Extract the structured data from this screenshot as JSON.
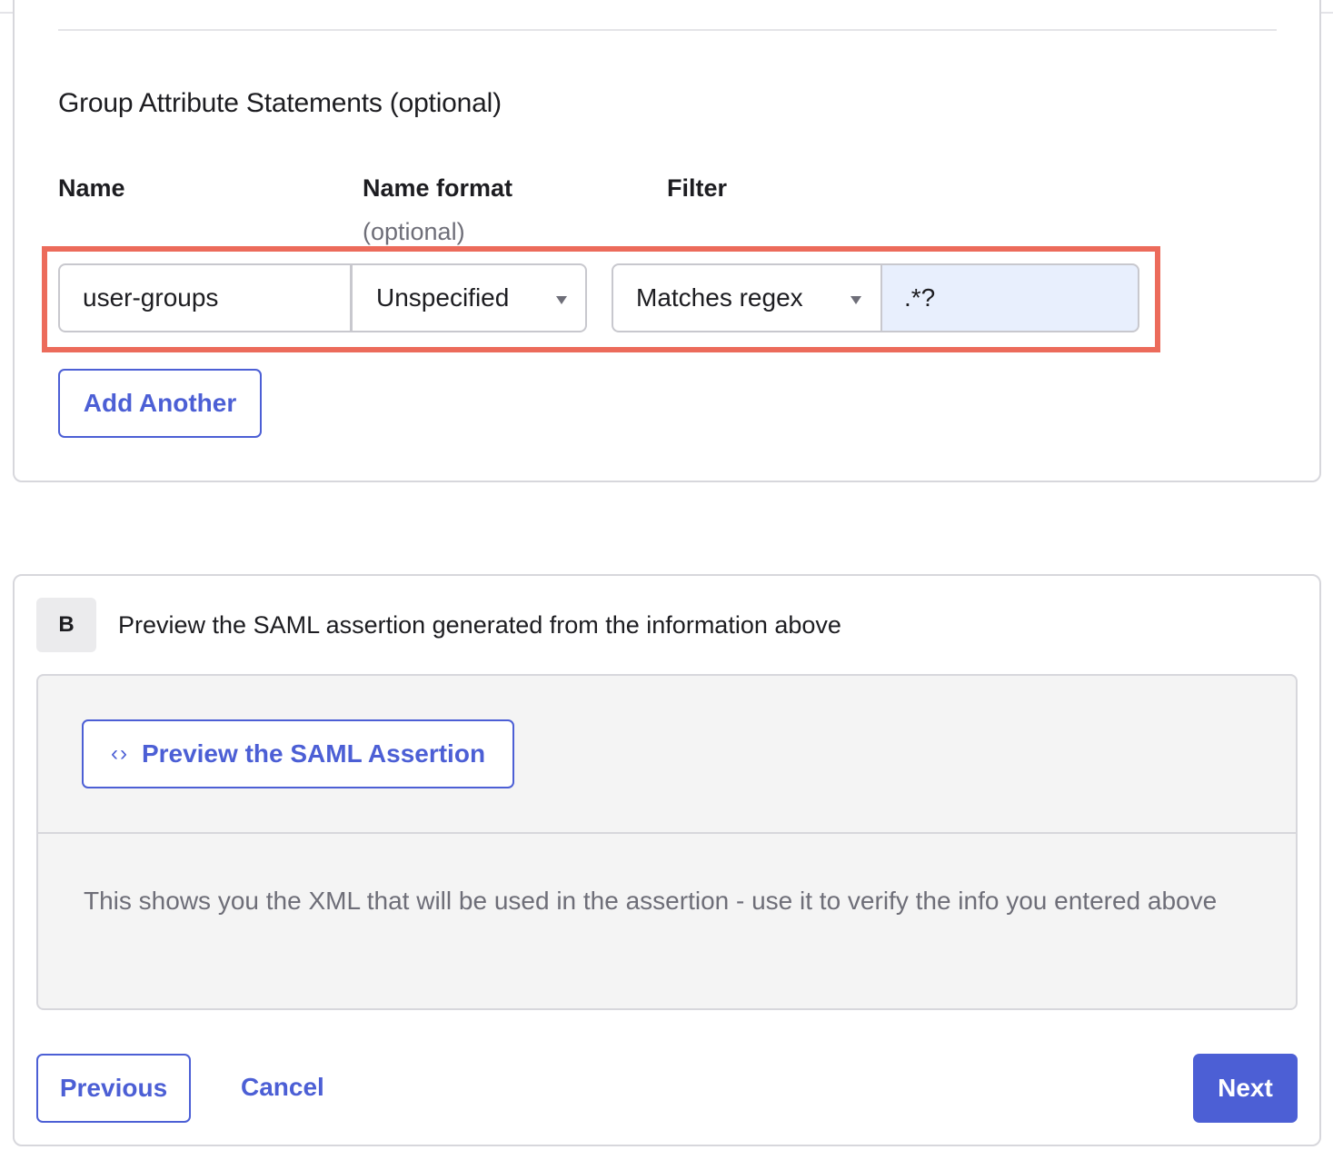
{
  "group_attributes": {
    "title": "Group Attribute Statements (optional)",
    "columns": {
      "name": "Name",
      "name_format": "Name format",
      "name_format_hint": "(optional)",
      "filter": "Filter"
    },
    "row": {
      "name_value": "user-groups",
      "name_format_value": "Unspecified",
      "filter_type_value": "Matches regex",
      "filter_value": ".*?"
    },
    "add_another_label": "Add Another",
    "highlight_color": "#ec6b5b"
  },
  "step_b": {
    "badge": "B",
    "title": "Preview the SAML assertion generated from the information above",
    "preview_button_label": "Preview the SAML Assertion",
    "preview_icon": "code-brackets-icon",
    "description": "This shows you the XML that will be used in the assertion - use it to verify the info you entered above"
  },
  "footer": {
    "previous_label": "Previous",
    "cancel_label": "Cancel",
    "next_label": "Next"
  },
  "colors": {
    "accent": "#4c5fd5",
    "regex_field_bg": "#e8effd"
  }
}
